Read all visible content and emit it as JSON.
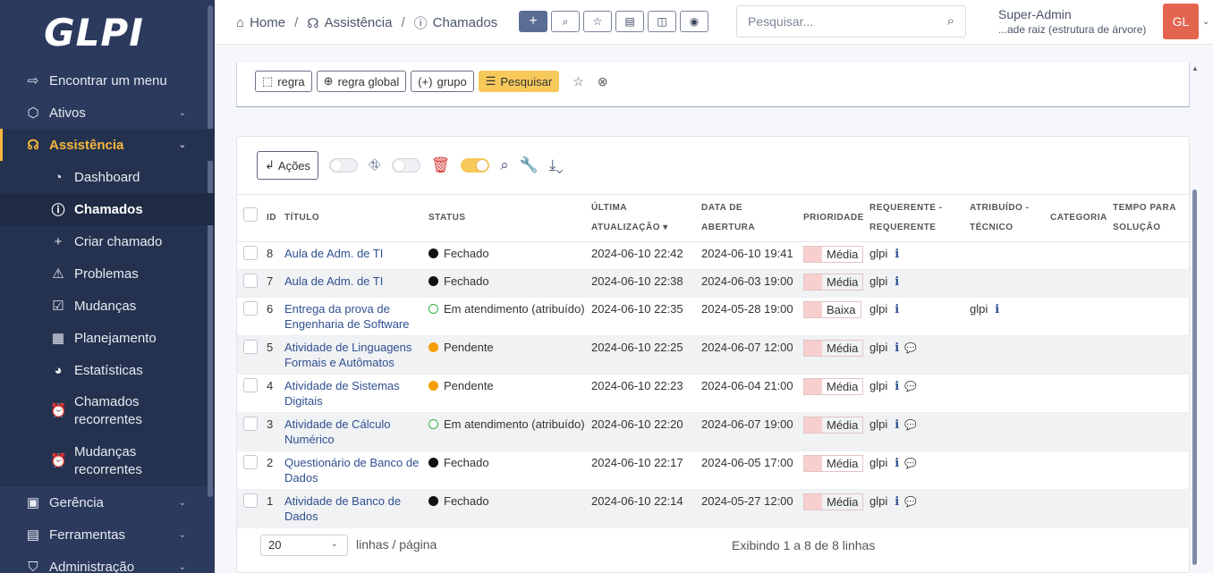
{
  "sidebar": {
    "logo": "GLPI",
    "items": [
      {
        "label": "Encontrar um menu",
        "icon": "arrow-right-icon"
      },
      {
        "label": "Ativos",
        "icon": "cube-icon"
      },
      {
        "label": "Assistência",
        "icon": "headset-icon"
      }
    ],
    "sub": [
      {
        "label": "Dashboard",
        "icon": "gauge-icon"
      },
      {
        "label": "Chamados",
        "icon": "alert-circle-icon"
      },
      {
        "label": "Criar chamado",
        "icon": "plus-icon"
      },
      {
        "label": "Problemas",
        "icon": "warning-triangle-icon"
      },
      {
        "label": "Mudanças",
        "icon": "clipboard-check-icon"
      },
      {
        "label": "Planejamento",
        "icon": "calendar-clock-icon"
      },
      {
        "label": "Estatísticas",
        "icon": "pie-chart-icon"
      },
      {
        "label": "Chamados recorrentes",
        "icon": "alarm-icon"
      },
      {
        "label": "Mudanças recorrentes",
        "icon": "alarm-icon"
      }
    ],
    "bottom": [
      {
        "label": "Gerência",
        "icon": "wallet-icon"
      },
      {
        "label": "Ferramentas",
        "icon": "briefcase-icon"
      },
      {
        "label": "Administração",
        "icon": "shield-icon"
      }
    ]
  },
  "header": {
    "breadcrumb": [
      "Home",
      "Assistência",
      "Chamados"
    ],
    "search_placeholder": "Pesquisar...",
    "user_name": "Super-Admin",
    "user_entity": "...ade raiz (estrutura de árvore)",
    "avatar": "GL"
  },
  "criteria": {
    "buttons": [
      "regra",
      "regra global",
      "grupo",
      "Pesquisar"
    ]
  },
  "toolbar": {
    "actions_label": "Ações"
  },
  "table": {
    "headers": {
      "id": "ID",
      "title": "Título",
      "status": "Status",
      "updated_1": "Última",
      "updated_2": "atualização",
      "opened": "Data de abertura",
      "priority": "Prioridade",
      "requester_1": "Requerente -",
      "requester_2": "Requerente",
      "assigned_1": "Atribuído -",
      "assigned_2": "Técnico",
      "category": "Categoria",
      "solve_1": "Tempo para",
      "solve_2": "solução"
    },
    "rows": [
      {
        "id": "8",
        "title": "Aula de Adm. de TI",
        "status": "Fechado",
        "updated": "2024-06-10 22:42",
        "opened": "2024-06-10 19:41",
        "priority": "Média",
        "requester": "glpi",
        "assigned": ""
      },
      {
        "id": "7",
        "title": "Aula de Adm. de TI",
        "status": "Fechado",
        "updated": "2024-06-10 22:38",
        "opened": "2024-06-03 19:00",
        "priority": "Média",
        "requester": "glpi",
        "assigned": ""
      },
      {
        "id": "6",
        "title": "Entrega da prova de Engenharia de Software",
        "status": "Em atendimento (atribuído)",
        "updated": "2024-06-10 22:35",
        "opened": "2024-05-28 19:00",
        "priority": "Baixa",
        "requester": "glpi",
        "assigned": "glpi"
      },
      {
        "id": "5",
        "title": "Atividade de Linguagens Formais e Autômatos",
        "status": "Pendente",
        "updated": "2024-06-10 22:25",
        "opened": "2024-06-07 12:00",
        "priority": "Média",
        "requester": "glpi",
        "assigned": ""
      },
      {
        "id": "4",
        "title": "Atividade de Sistemas Digitais",
        "status": "Pendente",
        "updated": "2024-06-10 22:23",
        "opened": "2024-06-04 21:00",
        "priority": "Média",
        "requester": "glpi",
        "assigned": ""
      },
      {
        "id": "3",
        "title": "Atividade de Cálculo Numérico",
        "status": "Em atendimento (atribuído)",
        "updated": "2024-06-10 22:20",
        "opened": "2024-06-07 19:00",
        "priority": "Média",
        "requester": "glpi",
        "assigned": ""
      },
      {
        "id": "2",
        "title": "Questionário de Banco de Dados",
        "status": "Fechado",
        "updated": "2024-06-10 22:17",
        "opened": "2024-06-05 17:00",
        "priority": "Média",
        "requester": "glpi",
        "assigned": ""
      },
      {
        "id": "1",
        "title": "Atividade de Banco de Dados",
        "status": "Fechado",
        "updated": "2024-06-10 22:14",
        "opened": "2024-05-27 12:00",
        "priority": "Média",
        "requester": "glpi",
        "assigned": ""
      }
    ]
  },
  "footer": {
    "per_page": "20",
    "per_page_label": "linhas / página",
    "count_text": "Exibindo 1 a 8 de 8 linhas"
  }
}
